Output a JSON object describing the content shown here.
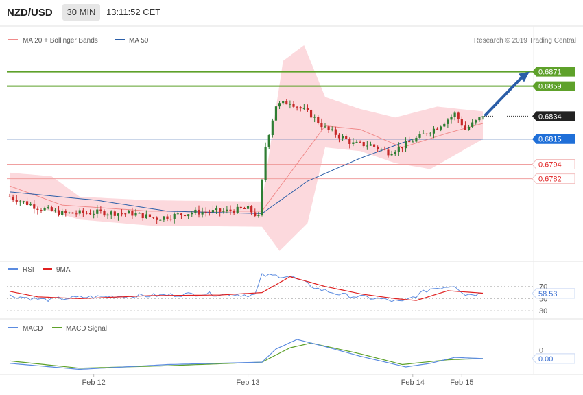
{
  "header": {
    "pair": "NZD/USD",
    "timeframe": "30 MIN",
    "clock": "13:11:52 CET"
  },
  "credit": "Research © 2019 Trading Central",
  "legend": {
    "ma20_bb": "MA 20 + Bollinger Bands",
    "ma50": "MA 50"
  },
  "colors": {
    "up": "#2e7d32",
    "down": "#c62828",
    "bb_fill": "#fcd9dd",
    "ma20": "#f08a8a",
    "ma50": "#2b5ea8",
    "target": "#5ea12a",
    "support": "#f0a0a0",
    "arrow": "#2b5ea8"
  },
  "price_labels": {
    "t1": "0.6871",
    "t2": "0.6859",
    "current": "0.6834",
    "ma50_val": "0.6815",
    "s1": "0.6794",
    "s2": "0.6782"
  },
  "x_labels": [
    "Feb 12",
    "Feb 13",
    "Feb 14",
    "Feb 15"
  ],
  "rsi": {
    "legend_rsi": "RSI",
    "legend_ma": "9MA",
    "ticks": [
      "70",
      "50",
      "30"
    ],
    "value": "58.53"
  },
  "macd": {
    "legend_macd": "MACD",
    "legend_signal": "MACD Signal",
    "tick": "0",
    "value": "0.00"
  },
  "chart_data": {
    "type": "line",
    "title": "NZD/USD",
    "xlabel": "",
    "ylabel": "",
    "price_panel": {
      "ylim": [
        0.6715,
        0.6905
      ],
      "levels": {
        "target_1": 0.6871,
        "target_2": 0.6859,
        "current": 0.6834,
        "ma50": 0.6815,
        "support_1": 0.6794,
        "support_2": 0.6782
      },
      "close_anchors": [
        {
          "bar": 0,
          "close": 0.6767
        },
        {
          "bar": 8,
          "close": 0.6758
        },
        {
          "bar": 15,
          "close": 0.6753
        },
        {
          "bar": 25,
          "close": 0.6754
        },
        {
          "bar": 35,
          "close": 0.6753
        },
        {
          "bar": 42,
          "close": 0.6749
        },
        {
          "bar": 52,
          "close": 0.6754
        },
        {
          "bar": 62,
          "close": 0.6755
        },
        {
          "bar": 68,
          "close": 0.6757
        },
        {
          "bar": 71,
          "close": 0.675
        },
        {
          "bar": 73,
          "close": 0.6809
        },
        {
          "bar": 76,
          "close": 0.6843
        },
        {
          "bar": 80,
          "close": 0.6846
        },
        {
          "bar": 86,
          "close": 0.6835
        },
        {
          "bar": 90,
          "close": 0.6824
        },
        {
          "bar": 95,
          "close": 0.6816
        },
        {
          "bar": 98,
          "close": 0.6811
        },
        {
          "bar": 103,
          "close": 0.681
        },
        {
          "bar": 108,
          "close": 0.6804
        },
        {
          "bar": 112,
          "close": 0.6809
        },
        {
          "bar": 117,
          "close": 0.6817
        },
        {
          "bar": 122,
          "close": 0.6825
        },
        {
          "bar": 127,
          "close": 0.6836
        },
        {
          "bar": 130,
          "close": 0.6823
        },
        {
          "bar": 135,
          "close": 0.6834
        }
      ],
      "ma50": [
        {
          "bar": 0,
          "value": 0.6771
        },
        {
          "bar": 25,
          "value": 0.6764
        },
        {
          "bar": 45,
          "value": 0.6755
        },
        {
          "bar": 72,
          "value": 0.6753
        },
        {
          "bar": 85,
          "value": 0.678
        },
        {
          "bar": 100,
          "value": 0.6799
        },
        {
          "bar": 115,
          "value": 0.6815
        },
        {
          "bar": 135,
          "value": 0.6815
        }
      ],
      "ma20": [
        {
          "bar": 0,
          "value": 0.6776
        },
        {
          "bar": 15,
          "value": 0.676
        },
        {
          "bar": 40,
          "value": 0.6755
        },
        {
          "bar": 72,
          "value": 0.6755
        },
        {
          "bar": 90,
          "value": 0.6826
        },
        {
          "bar": 100,
          "value": 0.6823
        },
        {
          "bar": 112,
          "value": 0.6808
        },
        {
          "bar": 125,
          "value": 0.682
        },
        {
          "bar": 135,
          "value": 0.6828
        }
      ],
      "bb_upper": [
        {
          "bar": 0,
          "value": 0.6787
        },
        {
          "bar": 12,
          "value": 0.6784
        },
        {
          "bar": 20,
          "value": 0.6767
        },
        {
          "bar": 40,
          "value": 0.6764
        },
        {
          "bar": 72,
          "value": 0.6763
        },
        {
          "bar": 78,
          "value": 0.688
        },
        {
          "bar": 84,
          "value": 0.6893
        },
        {
          "bar": 90,
          "value": 0.685
        },
        {
          "bar": 100,
          "value": 0.684
        },
        {
          "bar": 110,
          "value": 0.6833
        },
        {
          "bar": 122,
          "value": 0.6842
        },
        {
          "bar": 135,
          "value": 0.6838
        }
      ],
      "bb_lower": [
        {
          "bar": 0,
          "value": 0.6765
        },
        {
          "bar": 20,
          "value": 0.6748
        },
        {
          "bar": 40,
          "value": 0.6743
        },
        {
          "bar": 72,
          "value": 0.6742
        },
        {
          "bar": 77,
          "value": 0.6722
        },
        {
          "bar": 85,
          "value": 0.6745
        },
        {
          "bar": 90,
          "value": 0.6808
        },
        {
          "bar": 100,
          "value": 0.6805
        },
        {
          "bar": 110,
          "value": 0.6795
        },
        {
          "bar": 120,
          "value": 0.679
        },
        {
          "bar": 135,
          "value": 0.6815
        }
      ],
      "projection": {
        "from": 0.6834,
        "to": 0.6871
      }
    },
    "rsi_panel": {
      "ylim": [
        20,
        90
      ],
      "ticks": [
        70,
        50,
        30
      ],
      "last": 58.53,
      "rsi": [
        {
          "bar": 0,
          "value": 55
        },
        {
          "bar": 10,
          "value": 48
        },
        {
          "bar": 20,
          "value": 52
        },
        {
          "bar": 30,
          "value": 54
        },
        {
          "bar": 40,
          "value": 55
        },
        {
          "bar": 55,
          "value": 58
        },
        {
          "bar": 70,
          "value": 56
        },
        {
          "bar": 72,
          "value": 88
        },
        {
          "bar": 80,
          "value": 87
        },
        {
          "bar": 88,
          "value": 66
        },
        {
          "bar": 95,
          "value": 56
        },
        {
          "bar": 105,
          "value": 50
        },
        {
          "bar": 112,
          "value": 44
        },
        {
          "bar": 120,
          "value": 66
        },
        {
          "bar": 127,
          "value": 72
        },
        {
          "bar": 130,
          "value": 57
        },
        {
          "bar": 135,
          "value": 58.53
        }
      ],
      "ma9": [
        {
          "bar": 0,
          "value": 62
        },
        {
          "bar": 8,
          "value": 53
        },
        {
          "bar": 20,
          "value": 50
        },
        {
          "bar": 40,
          "value": 55
        },
        {
          "bar": 60,
          "value": 56
        },
        {
          "bar": 72,
          "value": 60
        },
        {
          "bar": 80,
          "value": 86
        },
        {
          "bar": 90,
          "value": 70
        },
        {
          "bar": 100,
          "value": 58
        },
        {
          "bar": 110,
          "value": 50
        },
        {
          "bar": 116,
          "value": 47
        },
        {
          "bar": 125,
          "value": 63
        },
        {
          "bar": 135,
          "value": 59
        }
      ]
    },
    "macd_panel": {
      "ylim": [
        -0.0009,
        0.0022
      ],
      "last": 0.0,
      "macd": [
        {
          "bar": 0,
          "value": -0.0002
        },
        {
          "bar": 20,
          "value": -0.0007
        },
        {
          "bar": 45,
          "value": -0.0003
        },
        {
          "bar": 72,
          "value": -0.0001
        },
        {
          "bar": 76,
          "value": 0.001
        },
        {
          "bar": 82,
          "value": 0.0018
        },
        {
          "bar": 90,
          "value": 0.0012
        },
        {
          "bar": 100,
          "value": 0.0004
        },
        {
          "bar": 113,
          "value": -0.0005
        },
        {
          "bar": 120,
          "value": -0.0002
        },
        {
          "bar": 127,
          "value": 0.0003
        },
        {
          "bar": 135,
          "value": 0.0002
        }
      ],
      "signal": [
        {
          "bar": 0,
          "value": 0.0
        },
        {
          "bar": 20,
          "value": -0.0006
        },
        {
          "bar": 45,
          "value": -0.0004
        },
        {
          "bar": 72,
          "value": -0.0001
        },
        {
          "bar": 80,
          "value": 0.0011
        },
        {
          "bar": 86,
          "value": 0.0015
        },
        {
          "bar": 100,
          "value": 0.0006
        },
        {
          "bar": 112,
          "value": -0.0003
        },
        {
          "bar": 125,
          "value": 0.0001
        },
        {
          "bar": 135,
          "value": 0.0002
        }
      ]
    }
  }
}
